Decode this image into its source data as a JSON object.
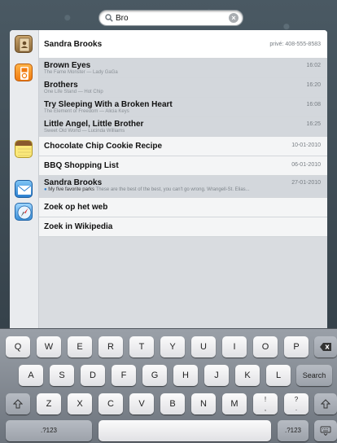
{
  "search": {
    "value": "Bro",
    "clear_icon": "clear-icon",
    "search_icon": "search-icon"
  },
  "results": {
    "contacts": {
      "icon": "contacts-icon",
      "rows": [
        {
          "title": "Sandra Brooks",
          "meta": "privé: 408-555-8583"
        }
      ]
    },
    "music": {
      "icon": "ipod-icon",
      "rows": [
        {
          "title": "Brown Eyes",
          "sub": "The Fame Monster — Lady GaGa",
          "meta": "16:02"
        },
        {
          "title": "Brothers",
          "sub": "One Life Stand — Hot Chip",
          "meta": "16:20"
        },
        {
          "title": "Try Sleeping With a Broken Heart",
          "sub": "The Element of Freedom — Alicia Keys",
          "meta": "16:08"
        },
        {
          "title": "Little Angel, Little Brother",
          "sub": "Sweet Old World — Lucinda Williams",
          "meta": "16:25"
        }
      ]
    },
    "notes": {
      "icon": "notes-icon",
      "rows": [
        {
          "title": "Chocolate Chip Cookie Recipe",
          "meta": "10-01-2010"
        },
        {
          "title": "BBQ Shopping List",
          "meta": "06-01-2010"
        }
      ]
    },
    "mail": {
      "icon": "mail-icon",
      "rows": [
        {
          "title": "Sandra Brooks",
          "meta": "27-01-2010",
          "snippet_subject": "My five favorite parks",
          "snippet_body": "These are the best of the best, you can't go wrong. Wrangell-St. Elias..."
        }
      ]
    },
    "web": {
      "icon": "safari-icon",
      "rows": [
        {
          "title": "Zoek op het web"
        },
        {
          "title": "Zoek in Wikipedia"
        }
      ]
    }
  },
  "keyboard": {
    "row1": [
      "Q",
      "W",
      "E",
      "R",
      "T",
      "Y",
      "U",
      "I",
      "O",
      "P"
    ],
    "row2": [
      "A",
      "S",
      "D",
      "F",
      "G",
      "H",
      "J",
      "K",
      "L"
    ],
    "row3": [
      "Z",
      "X",
      "C",
      "V",
      "B",
      "N",
      "M"
    ],
    "row3_punct": [
      {
        "top": "!",
        "bottom": ","
      },
      {
        "top": "?",
        "bottom": "."
      }
    ],
    "search_label": "Search",
    "numbers_label": ".?123",
    "delete_icon": "backspace-icon",
    "shift_icon": "shift-icon",
    "hide_keyboard_icon": "keyboard-hide-icon"
  }
}
